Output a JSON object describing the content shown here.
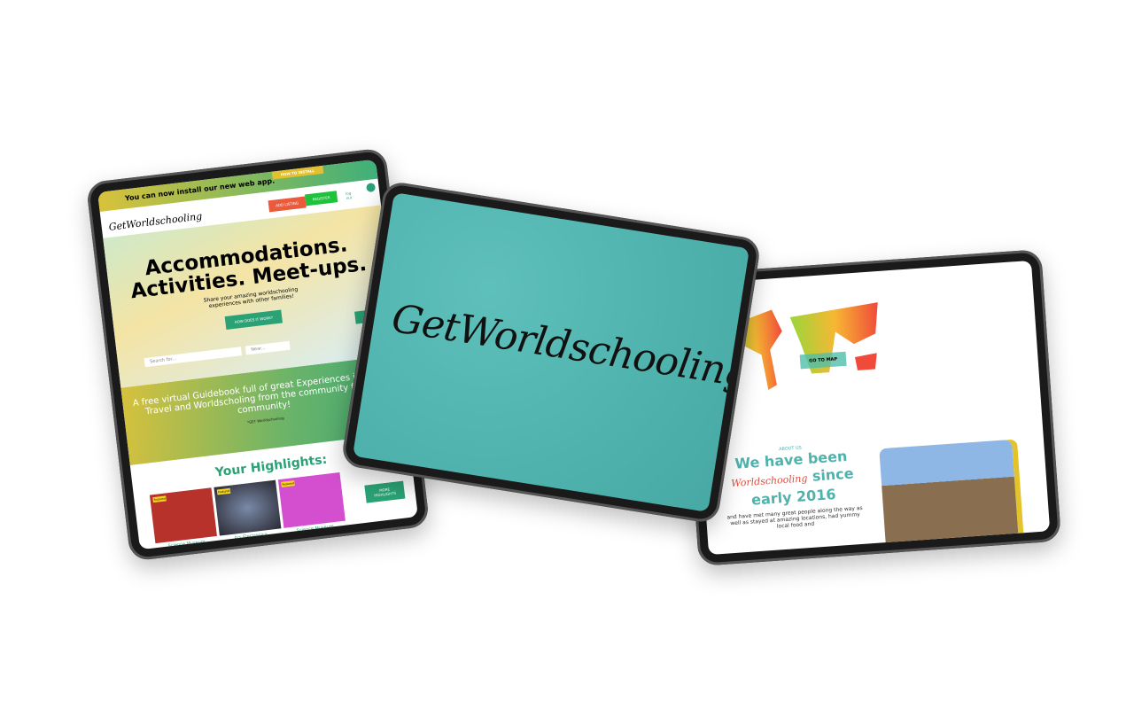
{
  "left_tablet": {
    "banner": "You can now install our new web app.",
    "install_button": "HOW TO INSTALL",
    "logo": "GetWorldschooling",
    "add_listing": "ADD LISTING",
    "register": "REGISTER",
    "logout": "log out",
    "hero_title_1": "Accommodations.",
    "hero_title_2": "Activities. Meet-ups.",
    "hero_sub": "Share your amazing worldschooling experiences with other families!",
    "how_button": "HOW DOES IT WORK?",
    "search_placeholder": "Search for...",
    "location_placeholder": "Near...",
    "search_button": "SEARCH",
    "tagline": "A free virtual Guidebook full of great Experiences in family Travel and Worldscholing from the community for the community!",
    "tagline_sign": "*GET Worldschooling",
    "highlights_title": "Your Highlights:",
    "cards": [
      {
        "label": "Science Museum",
        "badge": "Featured",
        "color": "#b7322a"
      },
      {
        "label": "Ars Electronica",
        "badge": "Featured",
        "color": "#3a3a44"
      },
      {
        "label": "Science Museum",
        "badge": "Featured",
        "color": "#d44fd0"
      }
    ],
    "more_button": "MORE HIGHLIGHTS"
  },
  "center_tablet": {
    "logo": "GetWorldschooling",
    "bg": "#4fb2ad"
  },
  "right_tablet": {
    "go_to_map": "GO TO MAP",
    "about_label": "ABOUT US",
    "heading_1": "We have been",
    "heading_script": "Worldschooling",
    "heading_2": "since",
    "heading_3": "early 2016",
    "body": "and have met many great people along the way as well as stayed at amazing locations, had yummy local food and"
  }
}
